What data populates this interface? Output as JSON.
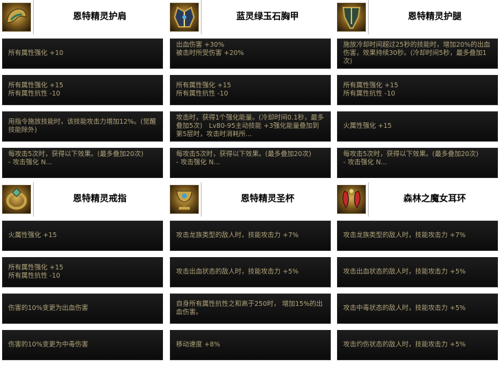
{
  "items": [
    {
      "name": "恩特精灵护肩",
      "icon": "shoulder-icon",
      "options": [
        "所有属性强化 +10",
        "所有属性强化 +15\n所有属性抗性 -10",
        "用指令施放技能时，该技能攻击力增加12%。(觉醒技能除外)",
        "每攻击5次时，获得以下效果。(最多叠加20次)\n- 攻击强化 N..."
      ]
    },
    {
      "name": "蓝灵绿玉石胸甲",
      "icon": "chest-armor-icon",
      "options": [
        "出血伤害 +30%\n被击时所受伤害 +20%",
        "所有属性强化 +15\n所有属性抗性 -10",
        "攻击时，获得1个强化能量。(冷却时间0.1秒，最多叠加5次)　Lv80-95主动技能 +3强化能量叠加到第5层时，攻击时消耗所...",
        "每攻击5次时，获得以下效果。(最多叠加20次)\n- 攻击强化 N..."
      ]
    },
    {
      "name": "恩特精灵护腿",
      "icon": "leg-armor-icon",
      "options": [
        "施放冷却时间超过25秒的技能时，增加20%的出血伤害，效果持续30秒。(冷却时间5秒，最多叠加1次)",
        "所有属性强化 +15\n所有属性抗性 -10",
        "火属性强化 +15",
        "每攻击5次时，获得以下效果。(最多叠加20次)\n- 攻击强化 N..."
      ]
    },
    {
      "name": "恩特精灵戒指",
      "icon": "ring-icon",
      "options": [
        "火属性强化 +15",
        "所有属性强化 +15\n所有属性抗性 -10",
        "伤害的10%变更为出血伤害",
        "伤害的10%变更为中毒伤害"
      ]
    },
    {
      "name": "恩特精灵圣杯",
      "icon": "chalice-icon",
      "options": [
        "攻击龙族类型的敌人时，技能攻击力 +7%",
        "攻击出血状态的敌人时，技能攻击力 +5%",
        "自身所有属性抗性之和高于250时， 增加15%的出血伤害。",
        "移动速度 +8%"
      ]
    },
    {
      "name": "森林之魔女耳环",
      "icon": "earring-icon",
      "options": [
        "攻击龙族类型的敌人时，技能攻击力 +7%",
        "攻击出血状态的敌人时，技能攻击力 +5%",
        "攻击中毒状态的敌人时，技能攻击力 +5%",
        "攻击灼伤状态的敌人时，技能攻击力 +5%"
      ]
    }
  ]
}
